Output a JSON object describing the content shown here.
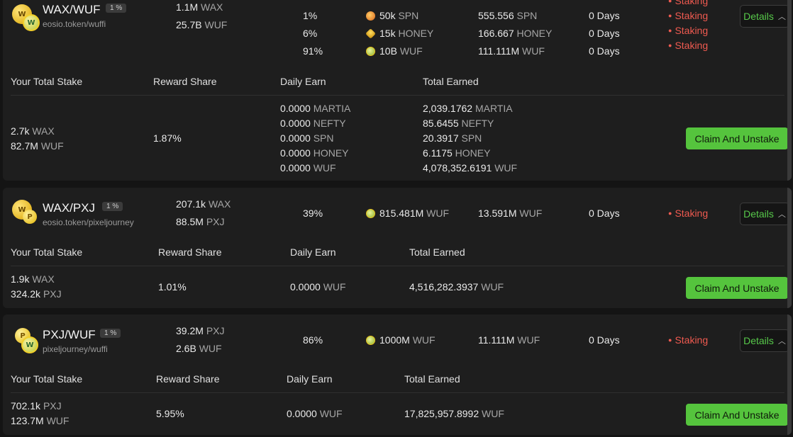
{
  "pools": [
    {
      "pair": "WAX/WUF",
      "fee": "1 %",
      "contract": "eosio.token/wuffi",
      "liquidity": [
        {
          "amount": "1.1M",
          "unit": "WAX"
        },
        {
          "amount": "25.7B",
          "unit": "WUF"
        }
      ],
      "rewards": [
        {
          "share": "1%",
          "icon": "spn-icon",
          "total": "50k",
          "token": "SPN",
          "rate": "555.556",
          "rate_unit": "SPN",
          "days": "0 Days",
          "status": "Staking"
        },
        {
          "share": "6%",
          "icon": "honey-icon",
          "total": "15k",
          "token": "HONEY",
          "rate": "166.667",
          "rate_unit": "HONEY",
          "days": "0 Days",
          "status": "Staking"
        },
        {
          "share": "91%",
          "icon": "wuf-icon",
          "total": "10B",
          "token": "WUF",
          "rate": "111.111M",
          "rate_unit": "WUF",
          "days": "0 Days",
          "status": "Staking"
        }
      ],
      "extra_status": "Staking",
      "details_label": "Details",
      "headers": {
        "stake": "Your Total Stake",
        "share": "Reward Share",
        "daily": "Daily Earn",
        "earned": "Total Earned"
      },
      "stake": [
        {
          "amount": "2.7k",
          "unit": "WAX"
        },
        {
          "amount": "82.7M",
          "unit": "WUF"
        }
      ],
      "reward_share": "1.87%",
      "daily_earn": [
        {
          "amount": "0.0000",
          "unit": "MARTIA"
        },
        {
          "amount": "0.0000",
          "unit": "NEFTY"
        },
        {
          "amount": "0.0000",
          "unit": "SPN"
        },
        {
          "amount": "0.0000",
          "unit": "HONEY"
        },
        {
          "amount": "0.0000",
          "unit": "WUF"
        }
      ],
      "total_earned": [
        {
          "amount": "2,039.1762",
          "unit": "MARTIA"
        },
        {
          "amount": "85.6455",
          "unit": "NEFTY"
        },
        {
          "amount": "20.3917",
          "unit": "SPN"
        },
        {
          "amount": "6.1175",
          "unit": "HONEY"
        },
        {
          "amount": "4,078,352.6191",
          "unit": "WUF"
        }
      ],
      "claim_label": "Claim And Unstake"
    },
    {
      "pair": "WAX/PXJ",
      "fee": "1 %",
      "contract": "eosio.token/pixeljourney",
      "liquidity": [
        {
          "amount": "207.1k",
          "unit": "WAX"
        },
        {
          "amount": "88.5M",
          "unit": "PXJ"
        }
      ],
      "rewards": [
        {
          "share": "39%",
          "icon": "wuf-icon",
          "total": "815.481M",
          "token": "WUF",
          "rate": "13.591M",
          "rate_unit": "WUF",
          "days": "0 Days",
          "status": "Staking"
        }
      ],
      "details_label": "Details",
      "headers": {
        "stake": "Your Total Stake",
        "share": "Reward Share",
        "daily": "Daily Earn",
        "earned": "Total Earned"
      },
      "stake": [
        {
          "amount": "1.9k",
          "unit": "WAX"
        },
        {
          "amount": "324.2k",
          "unit": "PXJ"
        }
      ],
      "reward_share": "1.01%",
      "daily_earn": [
        {
          "amount": "0.0000",
          "unit": "WUF"
        }
      ],
      "total_earned": [
        {
          "amount": "4,516,282.3937",
          "unit": "WUF"
        }
      ],
      "claim_label": "Claim And Unstake"
    },
    {
      "pair": "PXJ/WUF",
      "fee": "1 %",
      "contract": "pixeljourney/wuffi",
      "liquidity": [
        {
          "amount": "39.2M",
          "unit": "PXJ"
        },
        {
          "amount": "2.6B",
          "unit": "WUF"
        }
      ],
      "rewards": [
        {
          "share": "86%",
          "icon": "wuf-icon",
          "total": "1000M",
          "token": "WUF",
          "rate": "11.111M",
          "rate_unit": "WUF",
          "days": "0 Days",
          "status": "Staking"
        }
      ],
      "details_label": "Details",
      "headers": {
        "stake": "Your Total Stake",
        "share": "Reward Share",
        "daily": "Daily Earn",
        "earned": "Total Earned"
      },
      "stake": [
        {
          "amount": "702.1k",
          "unit": "PXJ"
        },
        {
          "amount": "123.7M",
          "unit": "WUF"
        }
      ],
      "reward_share": "5.95%",
      "daily_earn": [
        {
          "amount": "0.0000",
          "unit": "WUF"
        }
      ],
      "total_earned": [
        {
          "amount": "17,825,957.8992",
          "unit": "WUF"
        }
      ],
      "claim_label": "Claim And Unstake"
    }
  ],
  "colors": {
    "accent_green": "#55c43d",
    "staking_red": "#ef5a50",
    "background": "#141414"
  }
}
